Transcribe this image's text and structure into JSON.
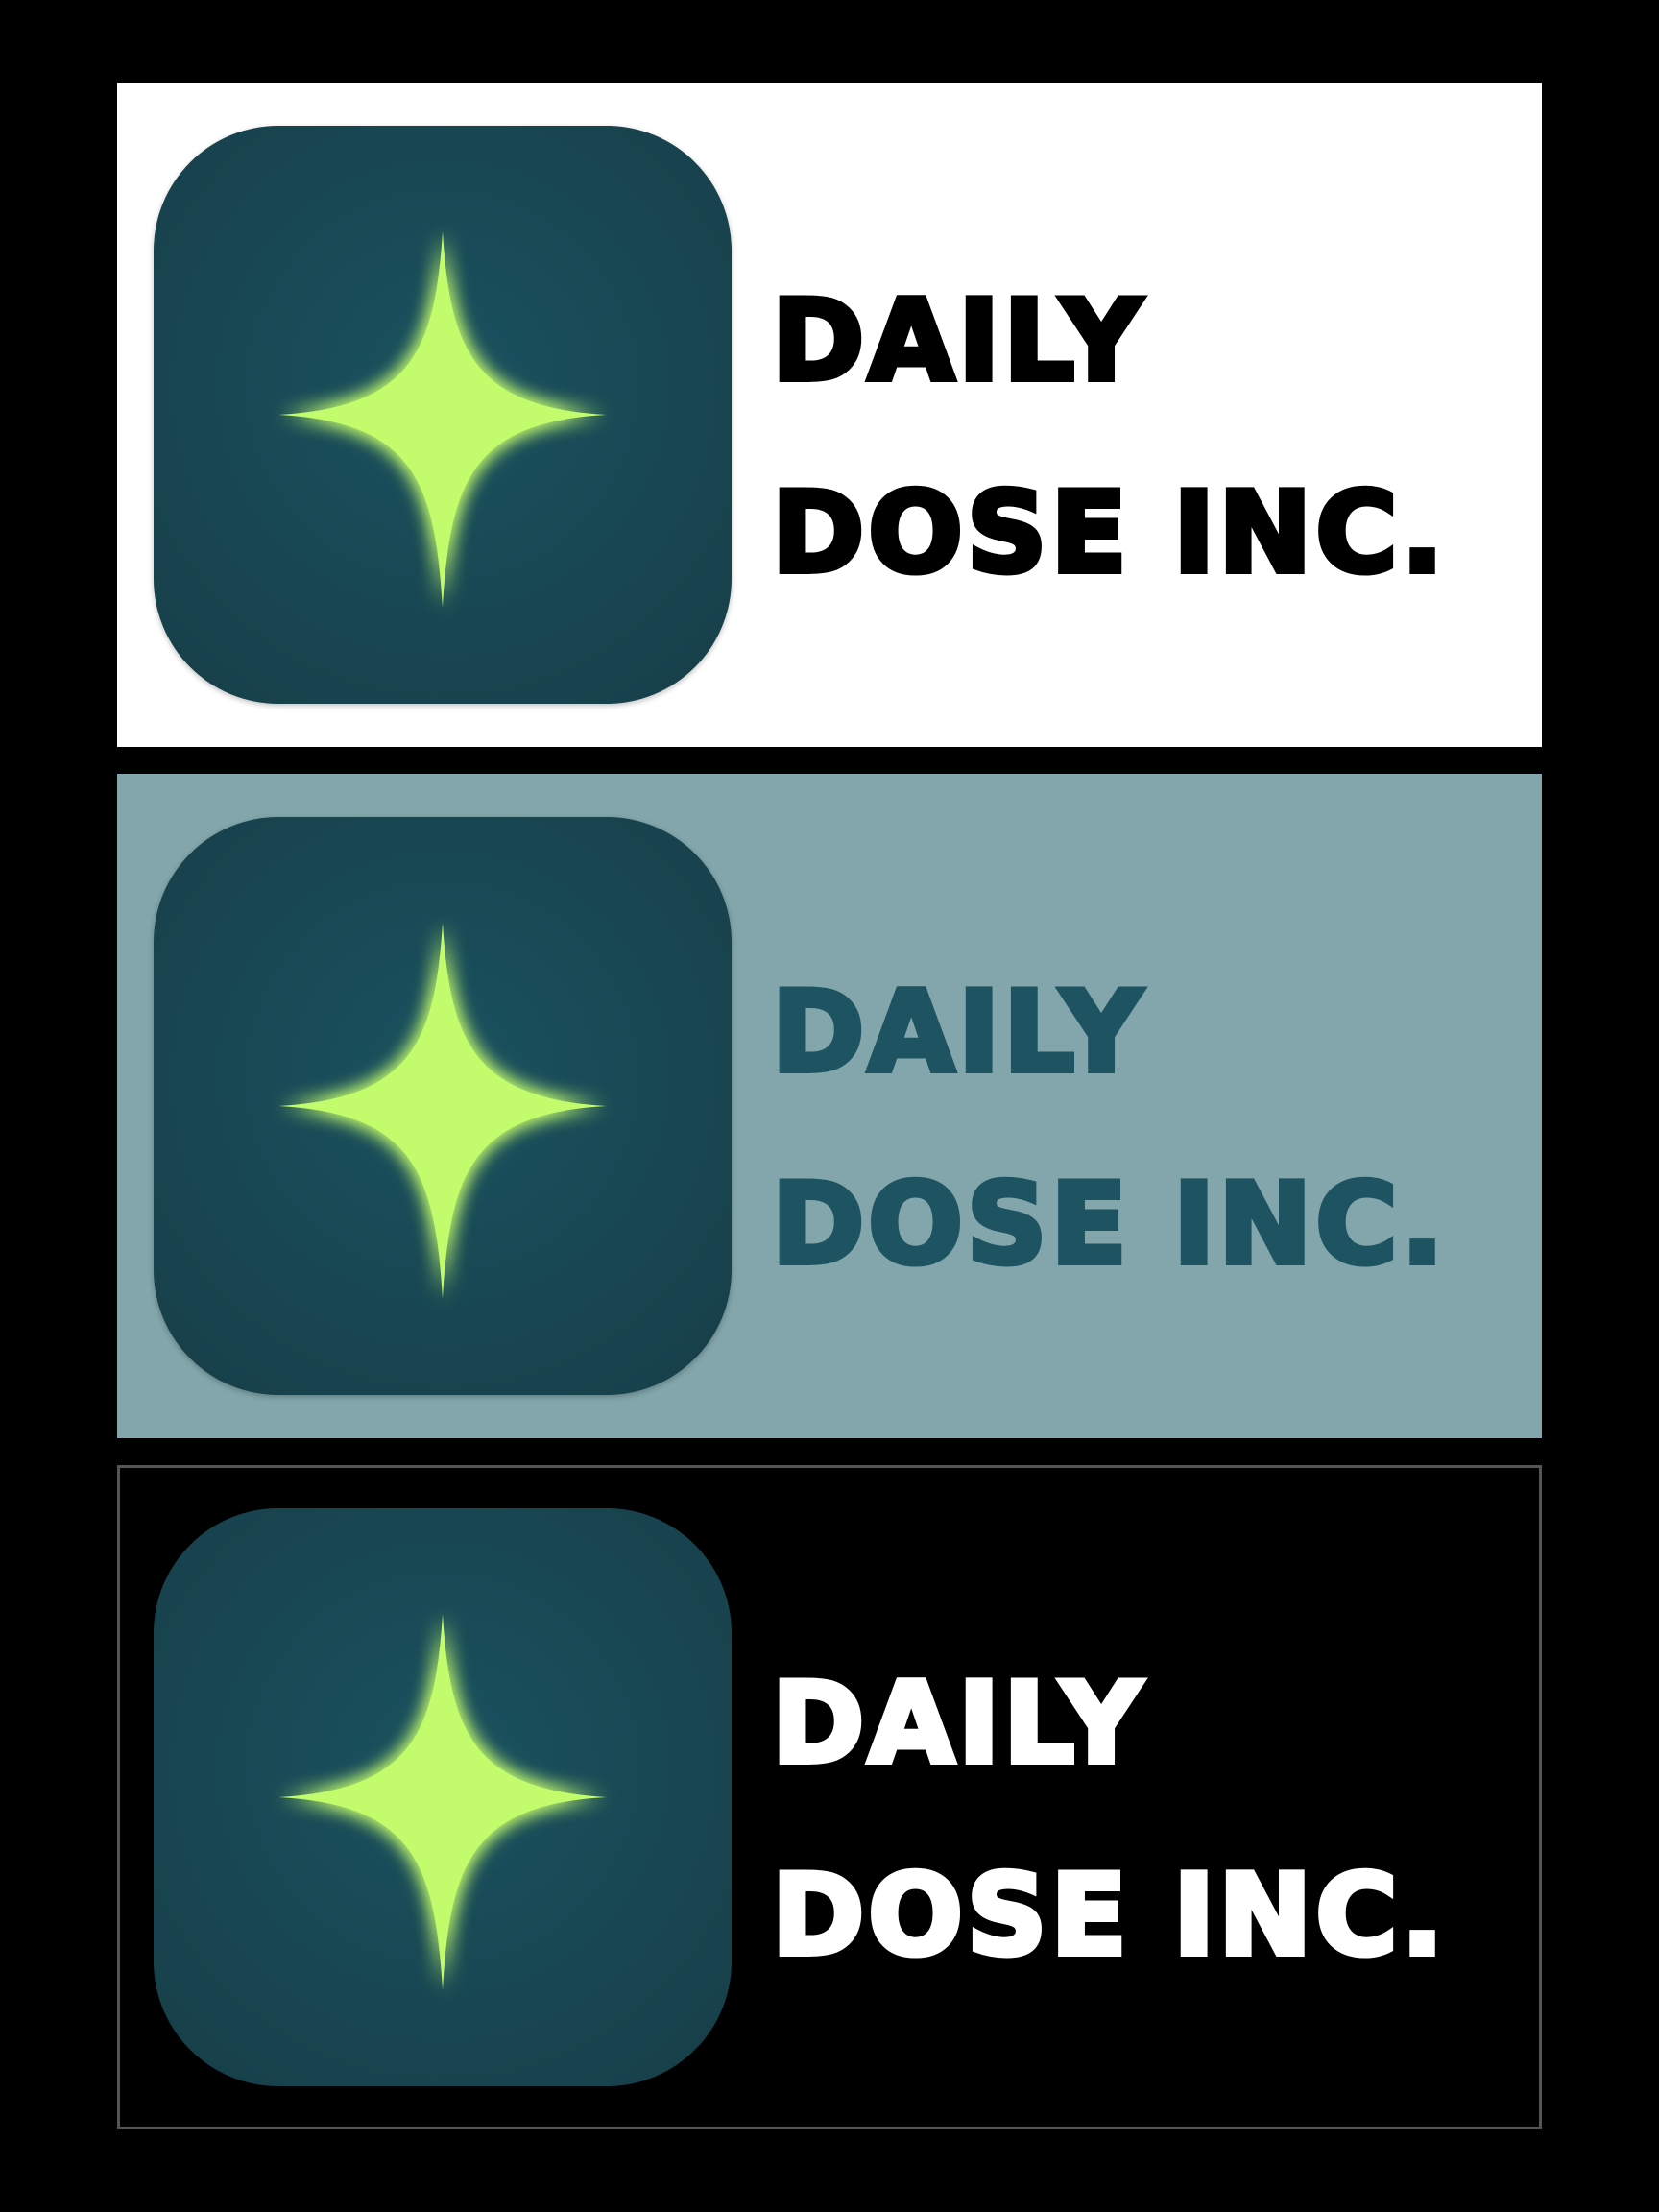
{
  "brand": {
    "name_line_1": "DAILY",
    "name_line_2": "DOSE INC."
  },
  "variants": [
    {
      "label": "light-background",
      "background_color": "#ffffff",
      "text_color": "#000000"
    },
    {
      "label": "teal-background",
      "background_color": "#82a6ab",
      "text_color": "#1e5461"
    },
    {
      "label": "dark-background",
      "background_color": "#000000",
      "text_color": "#ffffff",
      "border_color": "#555555"
    }
  ],
  "colors": {
    "page_background": "#000000",
    "icon_tile": "#1b4d58",
    "icon_tile_edge": "#163f4a",
    "sparkle": "#c2fb6c",
    "sparkle_glow": "#a8ff5a"
  },
  "icon": {
    "name": "sparkle-icon"
  }
}
